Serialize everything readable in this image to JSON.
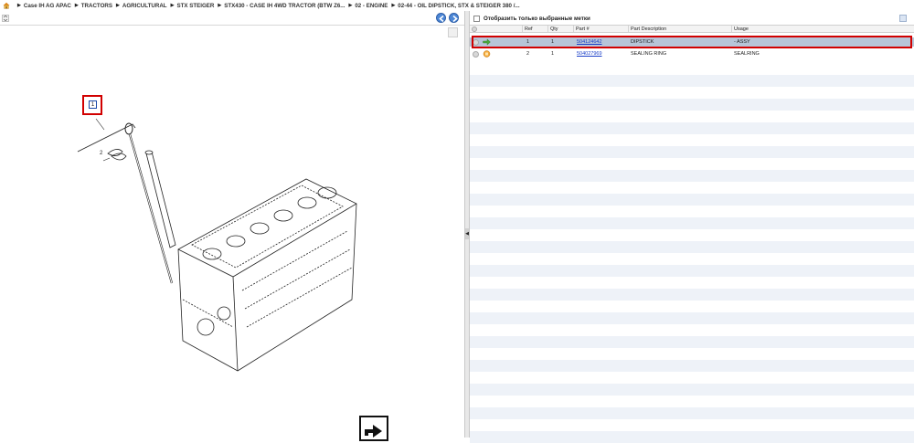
{
  "breadcrumb": {
    "items": [
      "Case IH AG APAC",
      "TRACTORS",
      "AGRICULTURAL",
      "STX STEIGER",
      "STX430 - CASE IH 4WD TRACTOR (BTW Z6...",
      "02 - ENGINE",
      "02-44 - OIL DIPSTICK, STX & STEIGER 380 /..."
    ]
  },
  "viewer": {
    "callout_label": "1",
    "ref2_label": "2"
  },
  "parts": {
    "filter_label": "Отобразить только выбранные метки",
    "columns": [
      "Ref",
      "Qty",
      "Part #",
      "Part Description",
      "Usage"
    ],
    "rows": [
      {
        "ref": "1",
        "qty": "1",
        "part": "504124642",
        "desc": "DIPSTICK",
        "usage": "- ASSY",
        "icon": "green-arrow-icon"
      },
      {
        "ref": "2",
        "qty": "1",
        "part": "504027969",
        "desc": "SEALING RING",
        "usage": "SEALRING",
        "icon": "orange-box-icon"
      }
    ]
  },
  "colors": {
    "selected_row": "#b7c5d8",
    "highlight": "#d10000",
    "link": "#1a3fc8",
    "stripe": "#eef2f8"
  }
}
